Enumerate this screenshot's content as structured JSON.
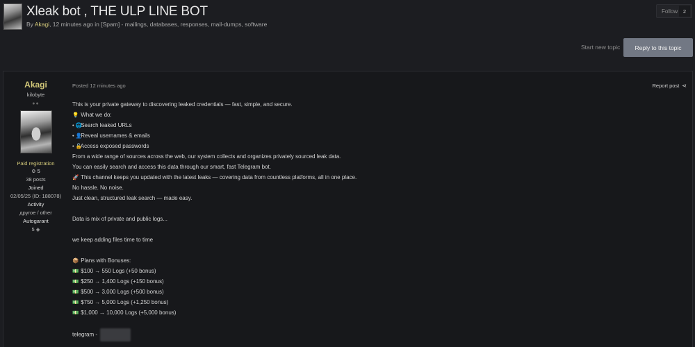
{
  "topic": {
    "title": "Xleak bot , THE ULP LINE BOT",
    "meta_by": "By ",
    "author": "Akagi",
    "meta_rest": ", 12 minutes ago in [Spam] - mailings, databases, responses, mail-dumps, software",
    "follow_label": "Follow",
    "follow_count": "2",
    "start_new_topic": "Start new topic",
    "reply_label": "Reply to this topic"
  },
  "author": {
    "name": "Akagi",
    "rank": "kilobyte",
    "group": "Paid registration",
    "reputation": "5",
    "posts": "38 posts",
    "joined_label": "Joined",
    "joined_value": "02/05/25 (ID: 188078)",
    "activity_label": "Activity",
    "activity_value": "другое / other",
    "autogarant_label": "Autogarant",
    "autogarant_value": "5"
  },
  "post": {
    "posted": "Posted 12 minutes ago",
    "report": "Report post",
    "lines": [
      {
        "icon": "",
        "text": "This is your private gateway to discovering leaked credentials — fast, simple, and secure."
      },
      {
        "icon": "💡",
        "text": " What we do:"
      },
      {
        "icon": "• 🌐",
        "text": " Search leaked URLs"
      },
      {
        "icon": "• 👤",
        "text": " Reveal usernames & emails"
      },
      {
        "icon": "• 🔓",
        "text": " Access exposed passwords"
      },
      {
        "icon": "",
        "text": "From a wide range of sources across the web, our system collects and organizes privately sourced leak data."
      },
      {
        "icon": "",
        "text": "You can easily search and access this data through our smart, fast Telegram bot."
      },
      {
        "icon": "🚀",
        "text": " This channel keeps you updated with the latest leaks — covering data from countless platforms, all in one place."
      },
      {
        "icon": "",
        "text": "No hassle. No noise."
      },
      {
        "icon": "",
        "text": "Just clean, structured leak search — made easy."
      },
      {
        "icon": "",
        "text": ""
      },
      {
        "icon": "",
        "text": "Data is mix of private and public logs..."
      },
      {
        "icon": "",
        "text": ""
      },
      {
        "icon": "",
        "text": "we keep adding files time to time"
      },
      {
        "icon": "",
        "text": ""
      },
      {
        "icon": "📦",
        "text": "  Plans with Bonuses:"
      },
      {
        "icon": "💵",
        "text": " $100 → 550 Logs (+50 bonus)"
      },
      {
        "icon": "💵",
        "text": " $250 → 1,400 Logs (+150 bonus)"
      },
      {
        "icon": "💵",
        "text": " $500 → 3,000 Logs (+500 bonus)"
      },
      {
        "icon": "💵",
        "text": " $750 → 5,000 Logs (+1,250 bonus)"
      },
      {
        "icon": "💵",
        "text": " $1,000 → 10,000 Logs (+5,000 bonus)"
      },
      {
        "icon": "",
        "text": ""
      },
      {
        "icon": "",
        "text": "telegram -"
      }
    ]
  }
}
